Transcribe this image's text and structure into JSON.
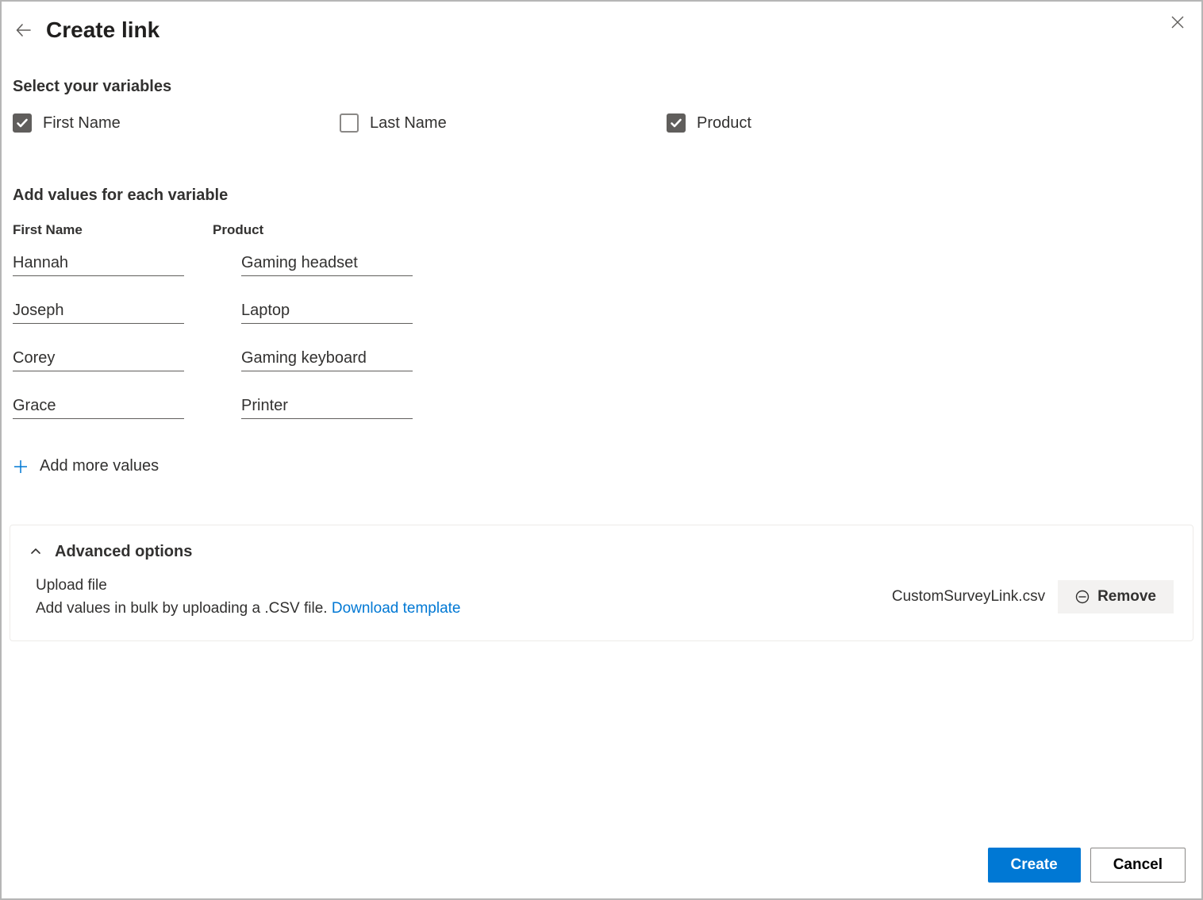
{
  "header": {
    "title": "Create link"
  },
  "variables": {
    "heading": "Select your variables",
    "items": [
      {
        "label": "First Name",
        "checked": true
      },
      {
        "label": "Last Name",
        "checked": false
      },
      {
        "label": "Product",
        "checked": true
      }
    ]
  },
  "values_section": {
    "heading": "Add values for each variable",
    "columns": [
      "First Name",
      "Product"
    ],
    "rows": [
      {
        "first_name": "Hannah",
        "product": "Gaming headset"
      },
      {
        "first_name": "Joseph",
        "product": "Laptop"
      },
      {
        "first_name": "Corey",
        "product": "Gaming keyboard"
      },
      {
        "first_name": "Grace",
        "product": "Printer"
      }
    ],
    "add_more_label": "Add more values"
  },
  "advanced": {
    "title": "Advanced options",
    "upload_label": "Upload file",
    "upload_desc": "Add values in bulk by uploading a .CSV file.",
    "download_link": "Download template",
    "file_name": "CustomSurveyLink.csv",
    "remove_label": "Remove"
  },
  "footer": {
    "create_label": "Create",
    "cancel_label": "Cancel"
  }
}
